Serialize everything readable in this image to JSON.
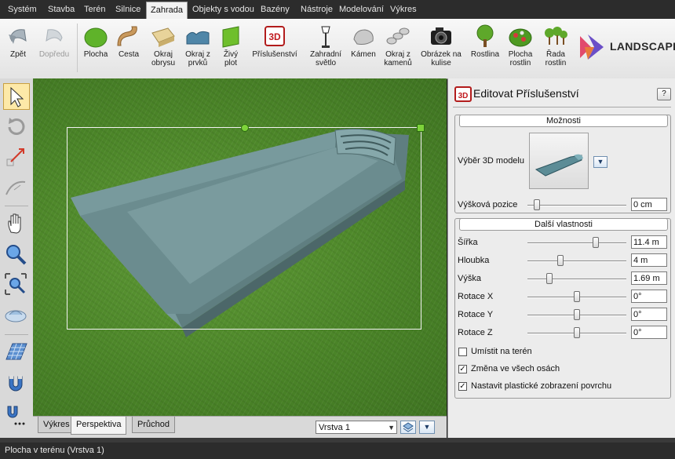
{
  "menubar": {
    "items": [
      "Systém",
      "Stavba",
      "Terén",
      "Silnice",
      "Zahrada",
      "Objekty s vodou",
      "Bazény",
      "Nástroje",
      "Modelování",
      "Výkres"
    ],
    "active": "Zahrada"
  },
  "ribbon": {
    "buttons": [
      {
        "label": "Zpět",
        "icon": "undo-icon",
        "enabled": true
      },
      {
        "label": "Dopředu",
        "icon": "redo-icon",
        "enabled": false
      },
      {
        "label": "Plocha",
        "icon": "green-area-icon",
        "enabled": true
      },
      {
        "label": "Cesta",
        "icon": "path-icon",
        "enabled": true
      },
      {
        "label": "Okraj\nobrysu",
        "icon": "outline-edge-icon",
        "enabled": true
      },
      {
        "label": "Okraj z\nprvků",
        "icon": "element-edge-icon",
        "enabled": true
      },
      {
        "label": "Živý\nplot",
        "icon": "hedge-icon",
        "enabled": true
      },
      {
        "label": "Příslušenství",
        "icon": "accessories-3d-icon",
        "enabled": true
      },
      {
        "label": "Zahradní\nsvětlo",
        "icon": "garden-lamp-icon",
        "enabled": true
      },
      {
        "label": "Kámen",
        "icon": "stone-icon",
        "enabled": true
      },
      {
        "label": "Okraj z\nkamenů",
        "icon": "stone-edge-icon",
        "enabled": true
      },
      {
        "label": "Obrázek na\nkulise",
        "icon": "camera-icon",
        "enabled": true
      },
      {
        "label": "Rostlina",
        "icon": "plant-icon",
        "enabled": true
      },
      {
        "label": "Plocha\nrostlin",
        "icon": "plant-area-icon",
        "enabled": true
      },
      {
        "label": "Řada\nrostlin",
        "icon": "plant-row-icon",
        "enabled": true
      }
    ],
    "logo_text": "LANDSCAPE D"
  },
  "left_toolbar": [
    "select-arrow-icon",
    "rotate-icon",
    "scale-icon",
    "curve-icon",
    "pan-hand-icon",
    "zoom-icon",
    "zoom-extents-icon",
    "orbit-icon",
    "grid-icon",
    "magnet-icon",
    "snap-more-icon"
  ],
  "view_tabs": [
    "Výkres",
    "Perspektiva",
    "Průchod"
  ],
  "active_view_tab": "Perspektiva",
  "layer": {
    "value": "Vrstva 1"
  },
  "panel": {
    "title": "Editovat Příslušenství",
    "help": "?",
    "options_header": "Možnosti",
    "model_label": "Výběr 3D modelu",
    "height_pos_label": "Výšková pozice",
    "height_pos_value": "0 cm",
    "height_pos_level": 0.02,
    "more_header": "Další vlastnosti",
    "properties": [
      {
        "label": "Šířka",
        "value": "11.4 m",
        "level": 0.7
      },
      {
        "label": "Hloubka",
        "value": "4 m",
        "level": 0.32
      },
      {
        "label": "Výška",
        "value": "1.69 m",
        "level": 0.2
      },
      {
        "label": "Rotace X",
        "value": "0°",
        "level": 0.5
      },
      {
        "label": "Rotace Y",
        "value": "0°",
        "level": 0.5
      },
      {
        "label": "Rotace Z",
        "value": "0°",
        "level": 0.5
      }
    ],
    "checkboxes": [
      {
        "label": "Umístit na terén",
        "checked": false
      },
      {
        "label": "Změna ve všech osách",
        "checked": true
      },
      {
        "label": "Nastavit plastické zobrazení povrchu",
        "checked": true
      }
    ]
  },
  "status": {
    "text": "Plocha v terénu (Vrstva 1)"
  },
  "colors": {
    "pool": "#6f8e91",
    "grass": "#4f8a2a",
    "accent_selection": "#fde9a8"
  }
}
